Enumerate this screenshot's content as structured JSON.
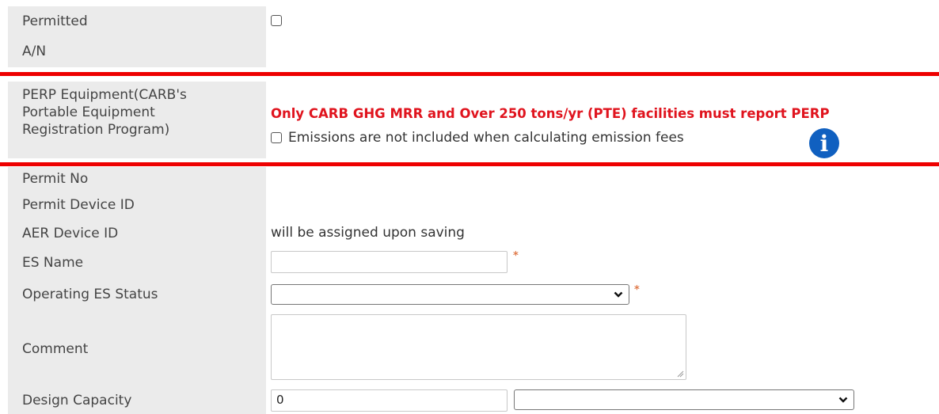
{
  "rows": {
    "permitted": {
      "label": "Permitted"
    },
    "an": {
      "label": "A/N"
    },
    "perp": {
      "label": "PERP Equipment(CARB's Portable Equipment Registration Program)",
      "warning": "Only CARB GHG MRR and Over 250 tons/yr (PTE) facilities must report PERP",
      "checkbox_label": "Emissions are not included when calculating emission fees",
      "info_glyph": "i"
    },
    "permit_no": {
      "label": "Permit No"
    },
    "permit_device_id": {
      "label": "Permit Device ID"
    },
    "aer_device_id": {
      "label": "AER Device ID",
      "value": "will be assigned upon saving"
    },
    "es_name": {
      "label": "ES Name",
      "value": "",
      "required_mark": "*"
    },
    "operating_es_status": {
      "label": "Operating ES Status",
      "selected": "",
      "required_mark": "*"
    },
    "comment": {
      "label": "Comment",
      "value": ""
    },
    "design_capacity": {
      "label": "Design Capacity",
      "value": "0",
      "unit_selected": ""
    }
  },
  "colors": {
    "label_bg": "#ebebeb",
    "highlight_border": "#ee0000",
    "warning_text": "#e0141e",
    "required": "#e07a4a",
    "info_icon": "#1060c0"
  },
  "icons": [
    "info-icon",
    "chevron-down-icon",
    "resize-handle-icon"
  ]
}
